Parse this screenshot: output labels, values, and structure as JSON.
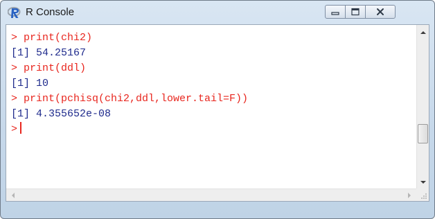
{
  "window": {
    "title": "R Console",
    "app_icon": "r-logo-icon",
    "controls": [
      "minimize-icon",
      "maximize-icon",
      "close-icon"
    ]
  },
  "console": {
    "lines": [
      {
        "type": "command",
        "text": "> print(chi2)"
      },
      {
        "type": "output",
        "text": "[1] 54.25167"
      },
      {
        "type": "command",
        "text": "> print(ddl)"
      },
      {
        "type": "output",
        "text": "[1] 10"
      },
      {
        "type": "command",
        "text": "> print(pchisq(chi2,ddl,lower.tail=F))"
      },
      {
        "type": "output",
        "text": "[1] 4.355652e-08"
      }
    ],
    "prompt": ">"
  },
  "vertical_scroll_position": 0.72,
  "colors": {
    "command": "#e8261e",
    "output": "#1e2a8c",
    "r_logo": "#2a63c2"
  }
}
